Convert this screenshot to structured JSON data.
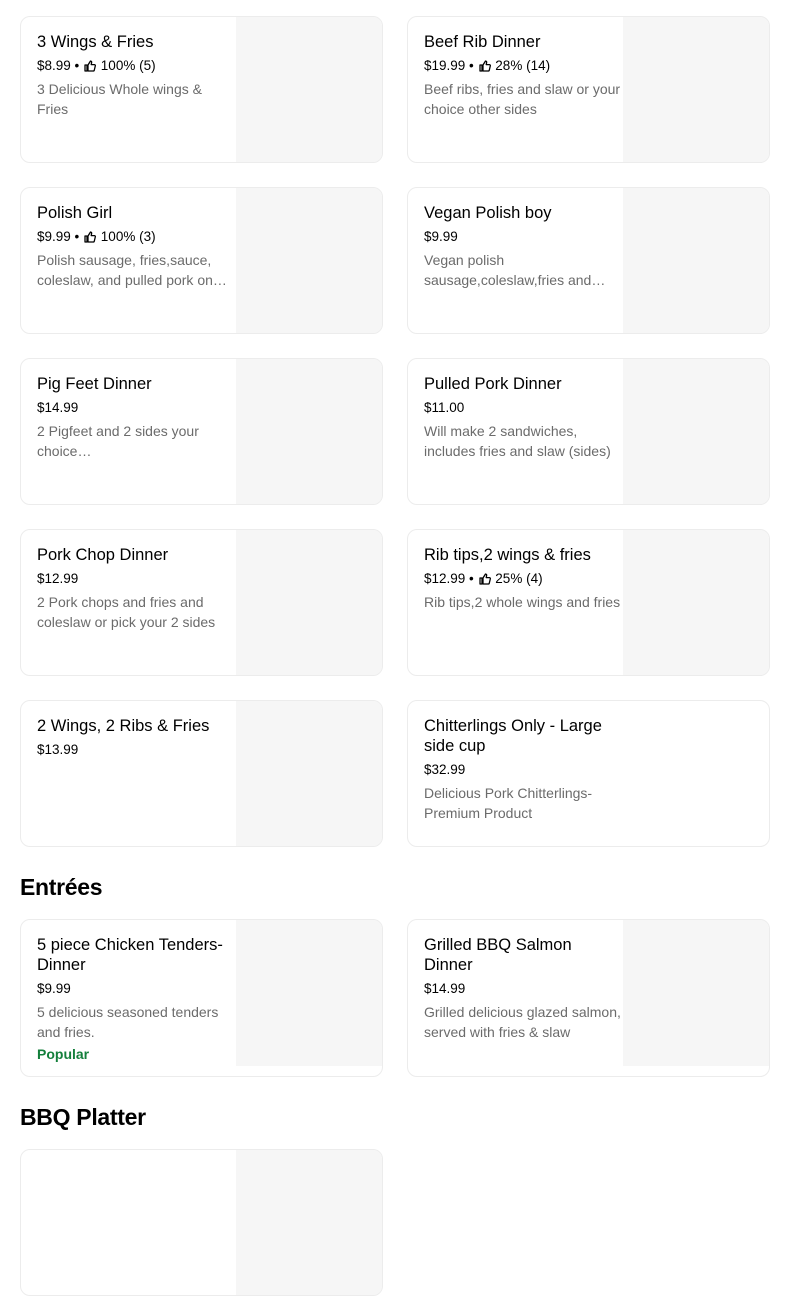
{
  "menu": {
    "items_top": [
      {
        "title": "3 Wings & Fries",
        "price": "$8.99",
        "rating": "100% (5)",
        "desc": "3 Delicious Whole wings & Fries"
      },
      {
        "title": "Beef Rib Dinner",
        "price": "$19.99",
        "rating": "28% (14)",
        "desc": "Beef ribs, fries and slaw or your choice other sides"
      },
      {
        "title": "Polish Girl",
        "price": "$9.99",
        "rating": "100% (3)",
        "desc": "Polish sausage, fries,sauce, coleslaw, and pulled pork on top"
      },
      {
        "title": "Vegan Polish boy",
        "price": "$9.99",
        "desc": "Vegan polish sausage,coleslaw,fries and sauce"
      },
      {
        "title": "Pig Feet Dinner",
        "price": "$14.99",
        "desc": "2 Pigfeet and 2 sides your choice…"
      },
      {
        "title": "Pulled Pork Dinner",
        "price": "$11.00",
        "desc": "Will make 2 sandwiches, includes fries and slaw (sides)"
      },
      {
        "title": "Pork Chop Dinner",
        "price": "$12.99",
        "desc": "2 Pork chops and fries and coleslaw or pick your 2 sides"
      },
      {
        "title": "Rib tips,2 wings & fries",
        "price": "$12.99",
        "rating": "25% (4)",
        "desc": "Rib tips,2 whole wings and fries"
      },
      {
        "title": "2 Wings, 2 Ribs & Fries",
        "price": "$13.99"
      },
      {
        "title": "Chitterlings Only - Large side cup",
        "price": "$32.99",
        "desc": "Delicious Pork Chitterlings-Premium Product"
      }
    ],
    "entrees": {
      "heading": "Entrées",
      "items": [
        {
          "title": "5 piece Chicken Tenders- Dinner",
          "price": "$9.99",
          "desc": "5 delicious seasoned tenders and fries.",
          "badge": "Popular"
        },
        {
          "title": "Grilled BBQ Salmon Dinner",
          "price": "$14.99",
          "desc": "Grilled delicious glazed salmon, served with fries & slaw"
        }
      ]
    },
    "bbq_platter": {
      "heading": "BBQ Platter"
    }
  },
  "icons": {
    "rating_icon": "thumbs-up-icon"
  },
  "colors": {
    "popular_badge": "#137f3b",
    "description": "#6b6b6b",
    "thumb_bg": "#f6f6f6",
    "card_border": "#ececec"
  }
}
